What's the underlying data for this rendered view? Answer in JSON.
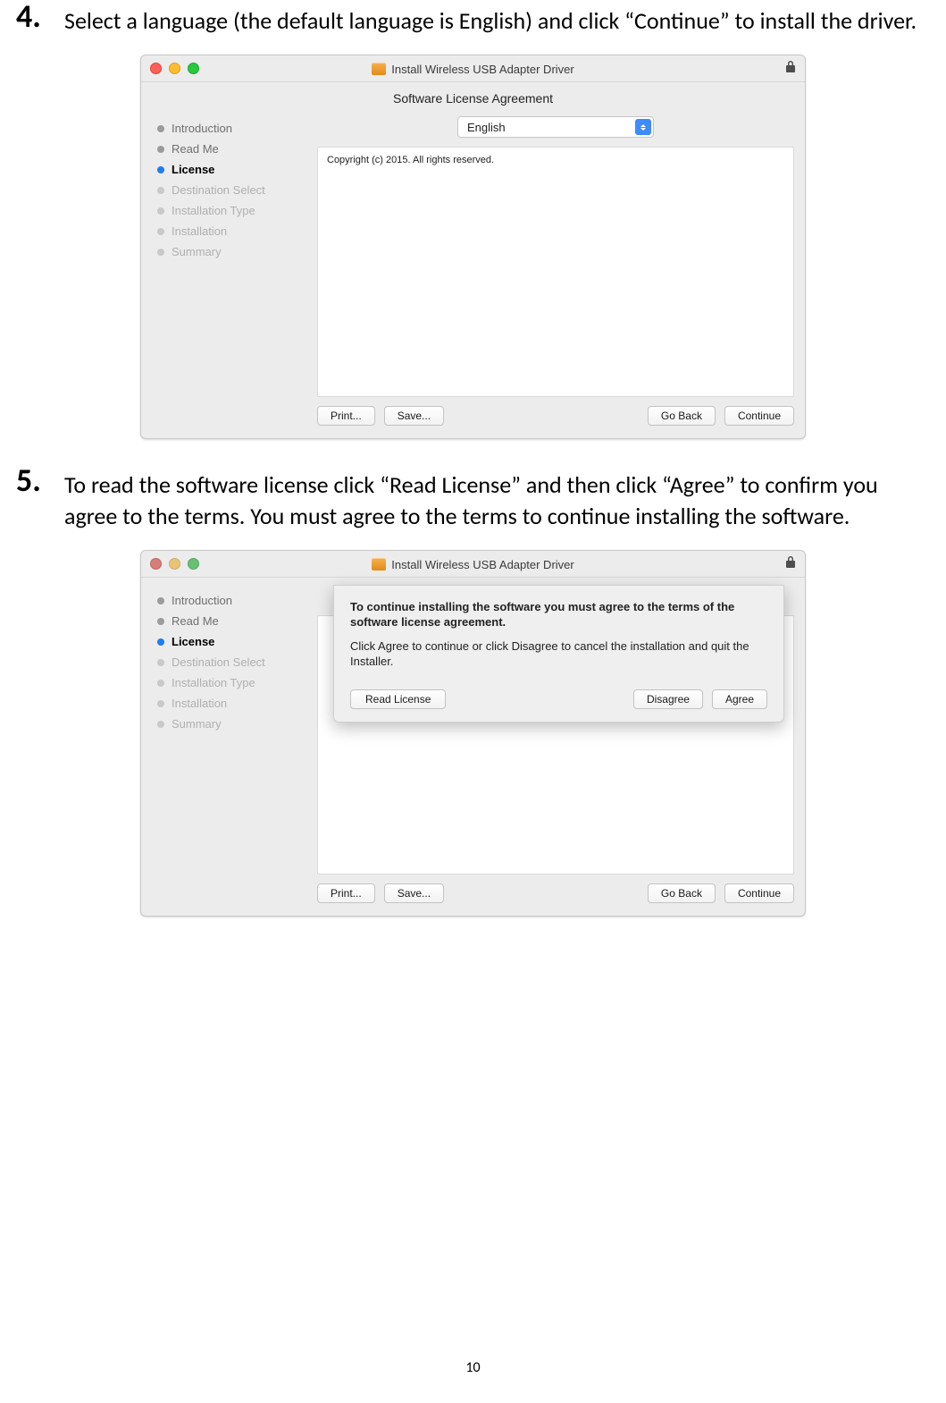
{
  "page_number": "10",
  "steps": {
    "s4": {
      "num": "4.",
      "text": "Select a language (the default language is English) and click “Continue” to install the driver."
    },
    "s5": {
      "num": "5.",
      "text": "To read the software license click “Read License” and then click “Agree” to confirm you agree to the terms. You must agree to the terms to continue installing the software."
    }
  },
  "window": {
    "title": "Install Wireless USB Adapter Driver",
    "subtitle": "Software License Agreement",
    "sidebar": [
      {
        "label": "Introduction",
        "state": "done"
      },
      {
        "label": "Read Me",
        "state": "done"
      },
      {
        "label": "License",
        "state": "current"
      },
      {
        "label": "Destination Select",
        "state": "pending"
      },
      {
        "label": "Installation Type",
        "state": "pending"
      },
      {
        "label": "Installation",
        "state": "pending"
      },
      {
        "label": "Summary",
        "state": "pending"
      }
    ],
    "language": "English",
    "license_text": "Copyright (c) 2015.  All rights reserved.",
    "buttons": {
      "print": "Print...",
      "save": "Save...",
      "back": "Go Back",
      "continue": "Continue"
    }
  },
  "sheet": {
    "heading": "To continue installing the software you must agree to the terms of the software license agreement.",
    "explain": "Click Agree to continue or click Disagree to cancel the installation and quit the Installer.",
    "buttons": {
      "read": "Read License",
      "disagree": "Disagree",
      "agree": "Agree"
    }
  }
}
